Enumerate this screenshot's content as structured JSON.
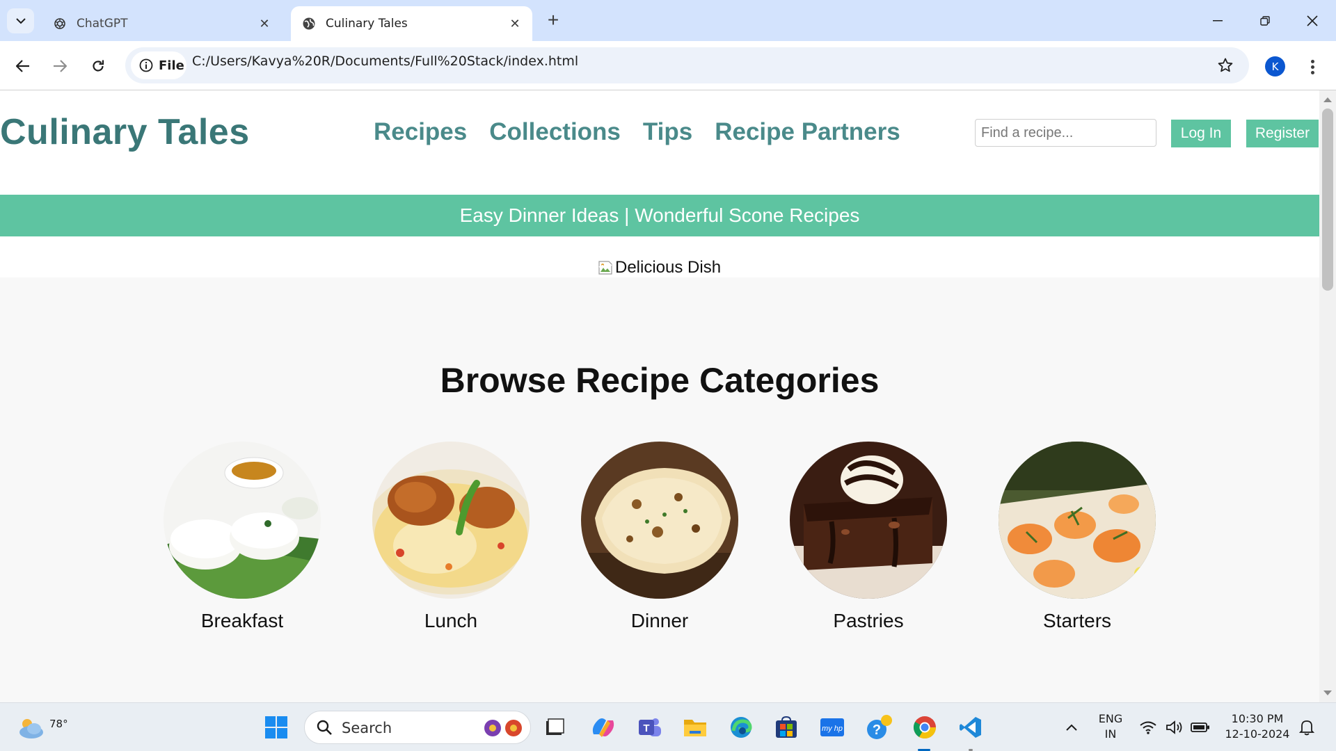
{
  "browser": {
    "tabs": [
      {
        "title": "ChatGPT",
        "active": false
      },
      {
        "title": "Culinary Tales",
        "active": true
      }
    ],
    "new_tab_label": "+",
    "site_chip": "File",
    "url": "C:/Users/Kavya%20R/Documents/Full%20Stack/index.html",
    "profile_initial": "K",
    "window_controls": {
      "minimize": "—",
      "restore": "❐",
      "close": "✕"
    }
  },
  "site": {
    "logo": "Culinary Tales",
    "nav": [
      "Recipes",
      "Collections",
      "Tips",
      "Recipe Partners"
    ],
    "search_placeholder": "Find a recipe...",
    "login_label": "Log In",
    "register_label": "Register",
    "banner": "Easy Dinner Ideas | Wonderful Scone Recipes",
    "hero_alt": "Delicious Dish",
    "categories_title": "Browse Recipe Categories",
    "categories": [
      {
        "label": "Breakfast"
      },
      {
        "label": "Lunch"
      },
      {
        "label": "Dinner"
      },
      {
        "label": "Pastries"
      },
      {
        "label": "Starters"
      }
    ]
  },
  "colors": {
    "brand_teal": "#3a7777",
    "nav_teal": "#4a8a8a",
    "accent_green": "#5ec4a1",
    "tab_strip": "#d3e3fd"
  },
  "taskbar": {
    "weather_temp": "78°",
    "search_label": "Search",
    "language_line1": "ENG",
    "language_line2": "IN",
    "time": "10:30 PM",
    "date": "12-10-2024"
  }
}
